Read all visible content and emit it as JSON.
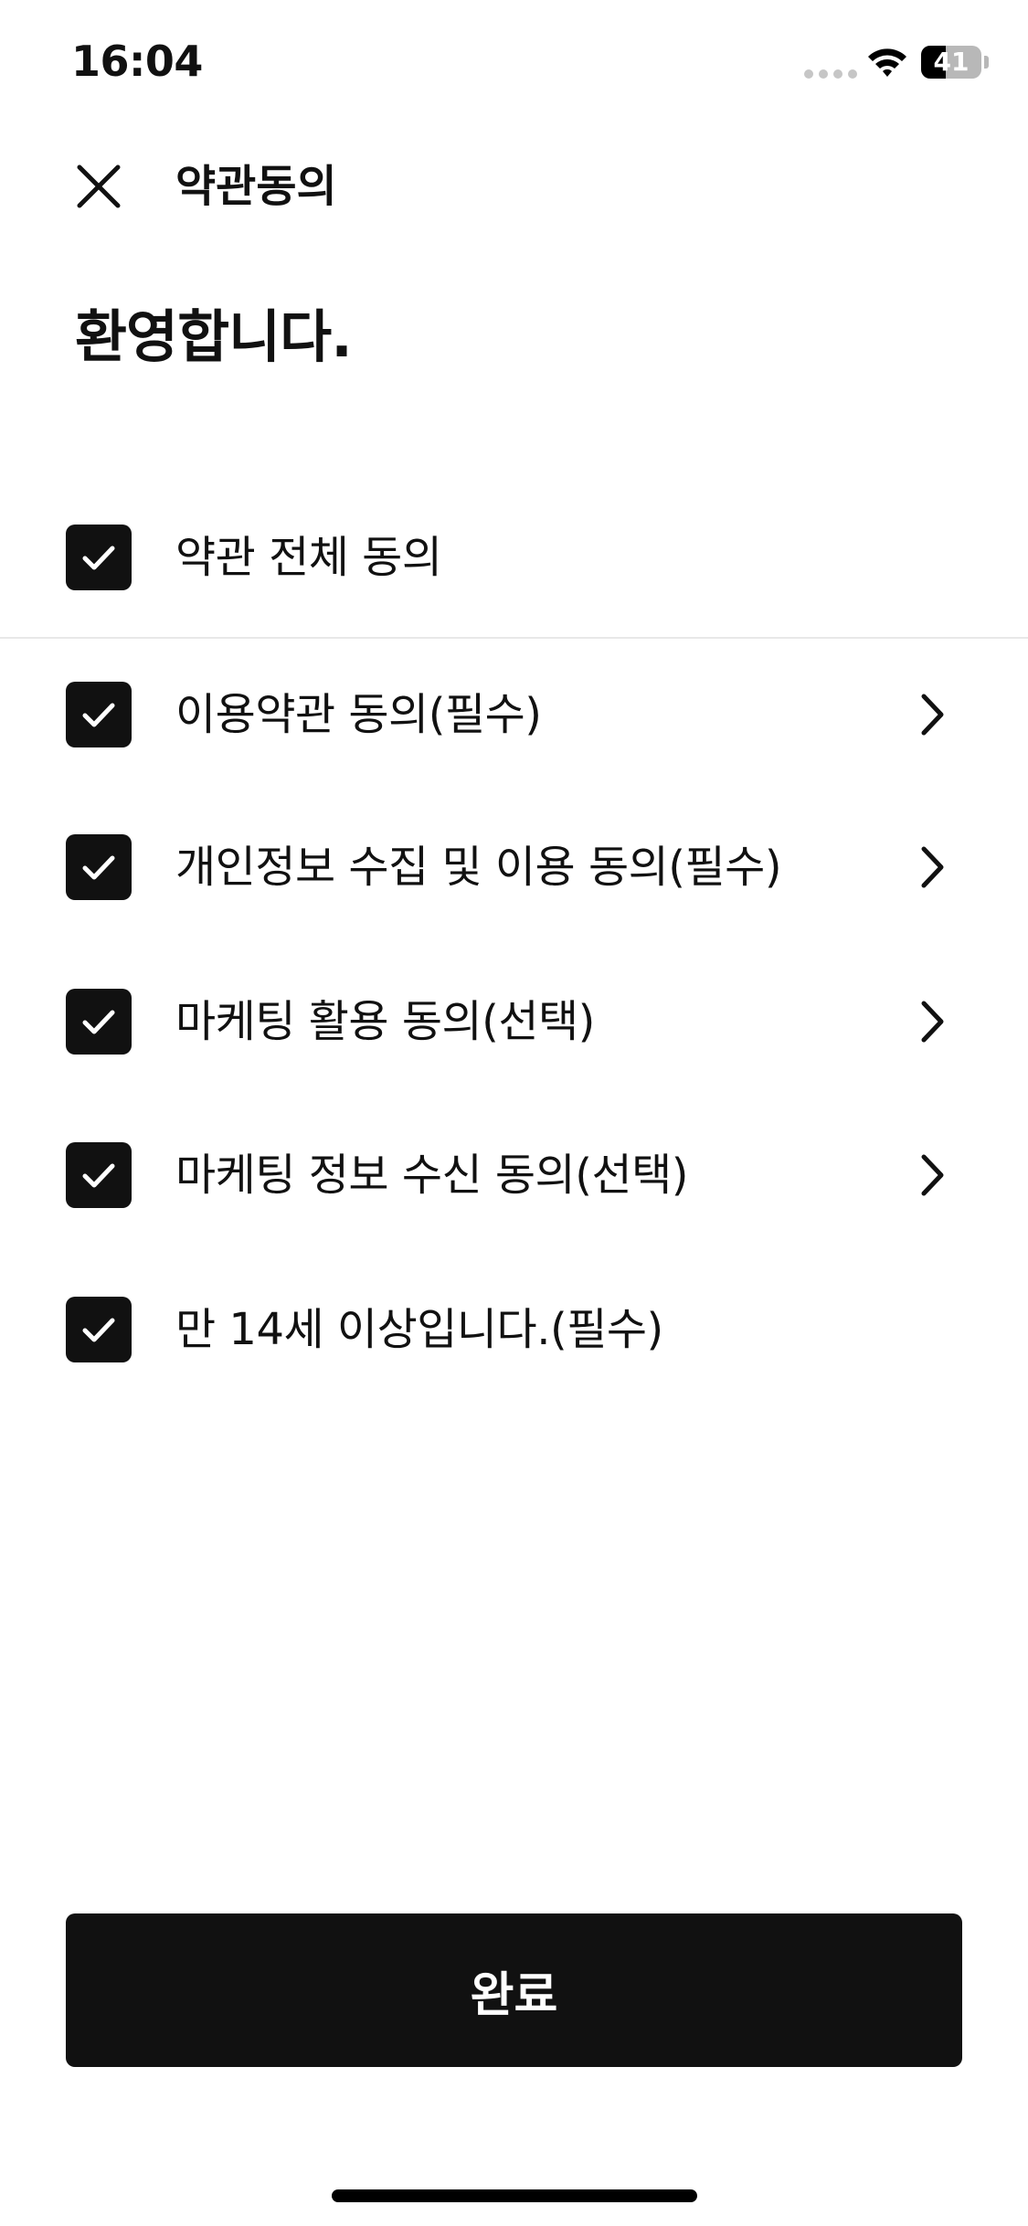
{
  "status_bar": {
    "time": "16:04",
    "battery_level": "41",
    "battery_fraction": 0.41
  },
  "header": {
    "title": "약관동의",
    "close_icon": "close-icon"
  },
  "welcome_text": "환영합니다.",
  "agree_all": {
    "label": "약관 전체 동의",
    "checked": true
  },
  "terms": [
    {
      "label": "이용약관 동의(필수)",
      "checked": true,
      "has_detail": true
    },
    {
      "label": "개인정보 수집 및 이용 동의(필수)",
      "checked": true,
      "has_detail": true
    },
    {
      "label": "마케팅 활용 동의(선택)",
      "checked": true,
      "has_detail": true
    },
    {
      "label": "마케팅 정보 수신 동의(선택)",
      "checked": true,
      "has_detail": true
    },
    {
      "label": "만 14세 이상입니다.(필수)",
      "checked": true,
      "has_detail": false
    }
  ],
  "complete_button": {
    "label": "완료"
  },
  "colors": {
    "primary": "#111111",
    "background": "#ffffff",
    "divider": "#e8e8e8"
  }
}
